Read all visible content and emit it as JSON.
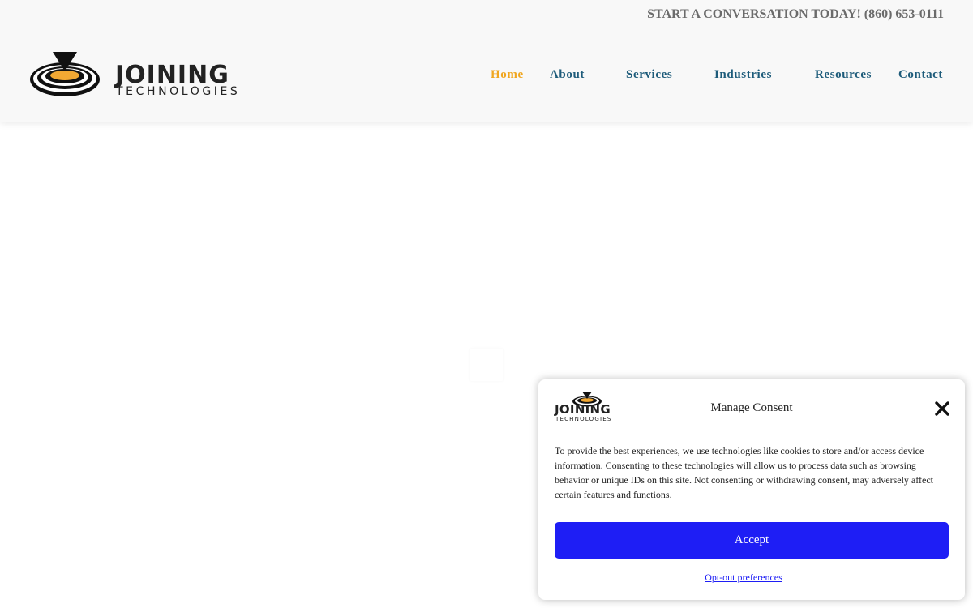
{
  "header": {
    "cta_text": "START A CONVERSATION TODAY! (860) 653-0111",
    "logo": {
      "word": "JOINING",
      "sub": "TECHNOLOGIES"
    },
    "nav": [
      {
        "label": "Home",
        "active": true
      },
      {
        "label": "About",
        "active": false
      },
      {
        "label": "Services",
        "active": false
      },
      {
        "label": "Industries",
        "active": false
      },
      {
        "label": "Resources",
        "active": false
      },
      {
        "label": "Contact",
        "active": false
      }
    ]
  },
  "consent": {
    "logo_word": "JOINING",
    "logo_sub": "TECHNOLOGIES",
    "title": "Manage Consent",
    "close_icon": "close-icon",
    "text": "To provide the best experiences, we use technologies like cookies to store and/or access device information. Consenting to these technologies will allow us to process data such as browsing behavior or unique IDs on this site. Not consenting or withdrawing consent, may adversely affect certain features and functions.",
    "accept_label": "Accept",
    "optout_label": "Opt-out preferences"
  },
  "colors": {
    "nav": "#1d5b7a",
    "nav_active": "#f0a61f",
    "accept": "#1e1ef5",
    "cta": "#6b6b6b"
  }
}
